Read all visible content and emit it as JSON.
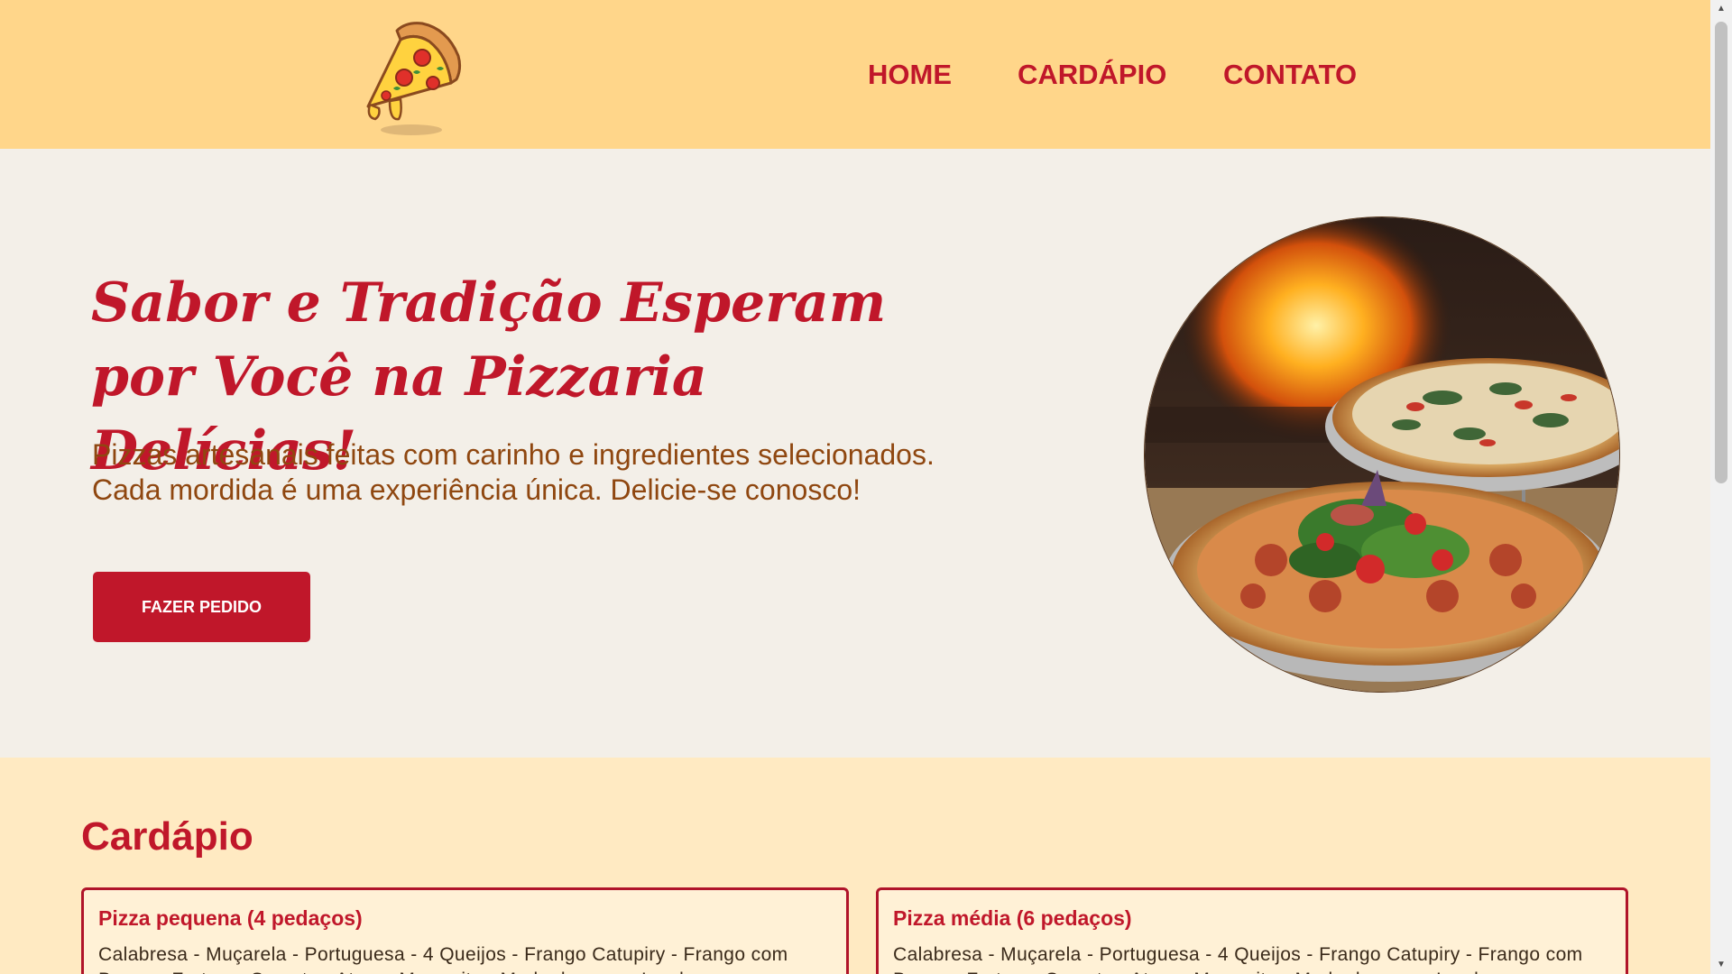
{
  "nav": {
    "items": [
      "HOME",
      "CARDÁPIO",
      "CONTATO"
    ],
    "logo_icon": "pizza-slice-icon"
  },
  "hero": {
    "title": "Sabor e Tradição Esperam por Você na Pizzaria Delícias!",
    "text": "Pizzas artesanais feitas com carinho e ingredientes selecionados. Cada mordida é uma experiência única. Delicie-se conosco!",
    "button_label": "FAZER PEDIDO",
    "image": "pizza-photo"
  },
  "menu": {
    "title": "Cardápio",
    "cards": [
      {
        "title": "Pizza pequena (4 pedaços)",
        "flavors": "Calabresa - Muçarela - Portuguesa - 4 Queijos - Frango Catupiry - Frango com Bacon - Fruto ao Sorvete - Atum - Margarita - Moda da casa - Lombo"
      },
      {
        "title": "Pizza média (6 pedaços)",
        "flavors": "Calabresa - Muçarela - Portuguesa - 4 Queijos - Frango Catupiry - Frango com Bacon - Fruto ao Sorvete - Atum - Margarita - Moda da casa - Lombo"
      }
    ]
  },
  "colors": {
    "header_bg": "#ffd68a",
    "hero_bg": "#f3efe8",
    "menu_bg": "#ffeac2",
    "accent_red": "#c0172a",
    "text_brown": "#8f4710"
  }
}
